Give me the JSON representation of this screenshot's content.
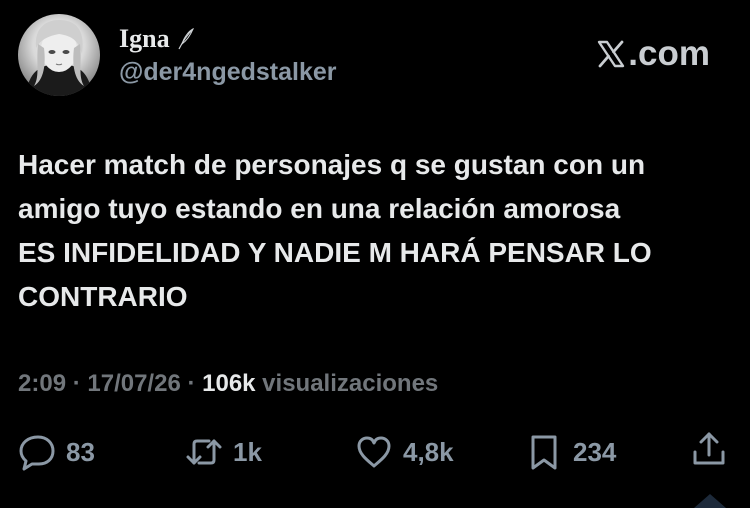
{
  "author": {
    "display_name": "Igna",
    "handle": "@der4ngedstalker"
  },
  "brand": {
    "label": ".com"
  },
  "tweet": {
    "lines": [
      "Hacer match de personajes q se gustan con un",
      "amigo tuyo estando en una relación amorosa",
      "ES INFIDELIDAD Y NADIE M HARÁ PENSAR LO",
      "CONTRARIO"
    ]
  },
  "meta": {
    "time": "2:09",
    "sep1": " · ",
    "date": "17/07/26",
    "sep2": " · ",
    "views_count": "106k",
    "views_label": " visualizaciones"
  },
  "actions": {
    "replies": "83",
    "reposts": "1k",
    "likes": "4,8k",
    "bookmarks": "234"
  },
  "icons": {
    "reply": "reply-icon",
    "repost": "repost-icon",
    "like": "heart-icon",
    "bookmark": "bookmark-icon",
    "share": "share-icon",
    "brand": "x-logo-icon",
    "badge": "feather-icon"
  },
  "colors": {
    "background": "#000000",
    "text": "#e7e9ea",
    "muted": "#71767b",
    "icon": "#8b98a5"
  }
}
